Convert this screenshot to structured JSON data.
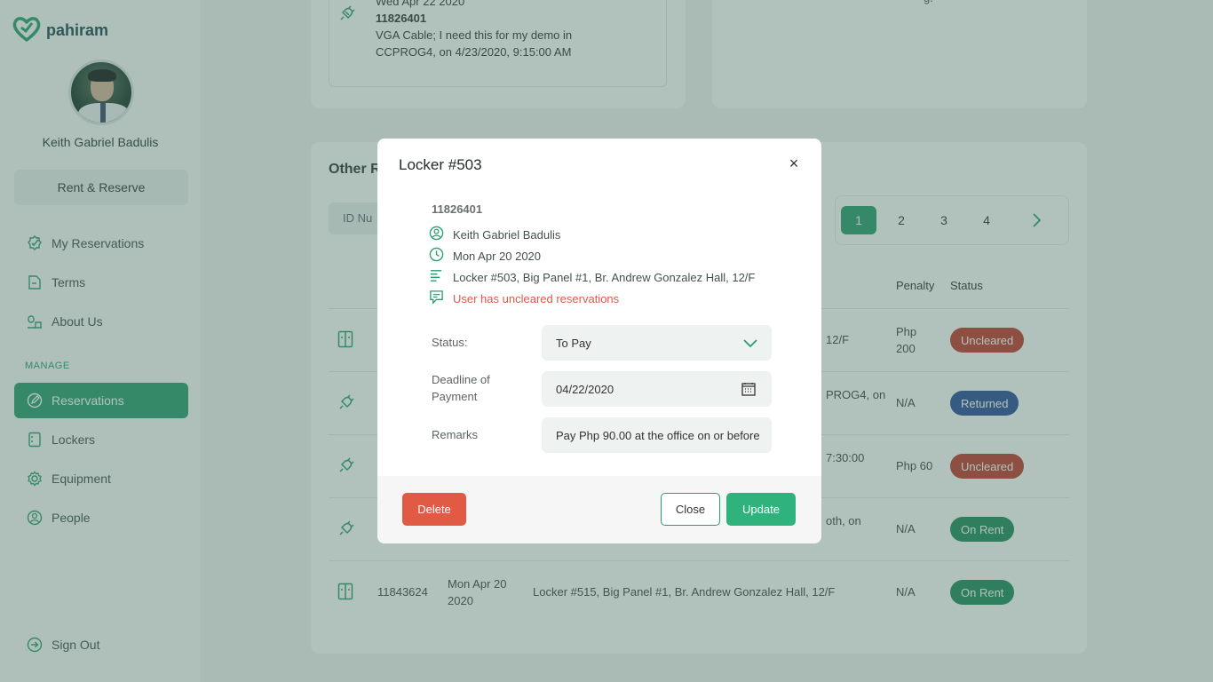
{
  "brand": {
    "name": "pahiram"
  },
  "user": {
    "name": "Keith Gabriel Badulis"
  },
  "sidebar": {
    "rent_reserve": "Rent & Reserve",
    "items": [
      {
        "label": "My Reservations",
        "icon": "check-badge-icon"
      },
      {
        "label": "Terms",
        "icon": "document-icon"
      },
      {
        "label": "About Us",
        "icon": "people-icon"
      }
    ],
    "manage_label": "MANAGE",
    "manage_items": [
      {
        "label": "Reservations",
        "icon": "pencil-circle-icon",
        "active": true
      },
      {
        "label": "Lockers",
        "icon": "locker-icon"
      },
      {
        "label": "Equipment",
        "icon": "gear-icon"
      },
      {
        "label": "People",
        "icon": "person-icon"
      }
    ],
    "signout": "Sign Out"
  },
  "background": {
    "top_card": {
      "date": "Wed Apr 22 2020",
      "id": "11826401",
      "line1": "VGA Cable; I need this for my demo in",
      "line2": "CCPROG4, on 4/23/2020, 9:15:00 AM"
    },
    "top_right_fragment": "g.",
    "section_title": "Other R",
    "filter_placeholder": "ID Nu",
    "pages": [
      "1",
      "2",
      "3",
      "4"
    ],
    "headers": {
      "penalty": "Penalty",
      "status": "Status"
    },
    "rows": [
      {
        "icon": "locker-icon",
        "details": "12/F",
        "penalty": "Php 200",
        "status": "Uncleared",
        "status_color": "#c0392b"
      },
      {
        "icon": "plug-icon",
        "details": "PROG4, on",
        "penalty": "N/A",
        "status": "Returned",
        "status_color": "#2e4d9a"
      },
      {
        "icon": "plug-icon",
        "details": "7:30:00",
        "penalty": "Php 60",
        "status": "Uncleared",
        "status_color": "#c0392b"
      },
      {
        "icon": "plug-icon",
        "details": "oth, on",
        "penalty": "N/A",
        "status": "On Rent",
        "status_color": "#1f8a5c"
      },
      {
        "icon": "locker-icon",
        "id": "11843624",
        "date": "Mon Apr 20 2020",
        "details": "Locker #515, Big Panel #1, Br. Andrew Gonzalez Hall, 12/F",
        "penalty": "N/A",
        "status": "On Rent",
        "status_color": "#1f8a5c"
      }
    ]
  },
  "modal": {
    "title": "Locker #503",
    "close_symbol": "×",
    "id": "11826401",
    "name": "Keith Gabriel Badulis",
    "date": "Mon Apr 20 2020",
    "location": "Locker #503, Big Panel #1, Br. Andrew Gonzalez Hall, 12/F",
    "warning": "User has uncleared reservations",
    "status_label": "Status:",
    "status_value": "To Pay",
    "deadline_label_1": "Deadline of",
    "deadline_label_2": "Payment",
    "deadline_value": "04/22/2020",
    "remarks_label": "Remarks",
    "remarks_value": "Pay Php 90.00 at the office on or before",
    "delete": "Delete",
    "close": "Close",
    "update": "Update"
  },
  "colors": {
    "accent": "#2a9d6e",
    "danger": "#e05a44"
  }
}
